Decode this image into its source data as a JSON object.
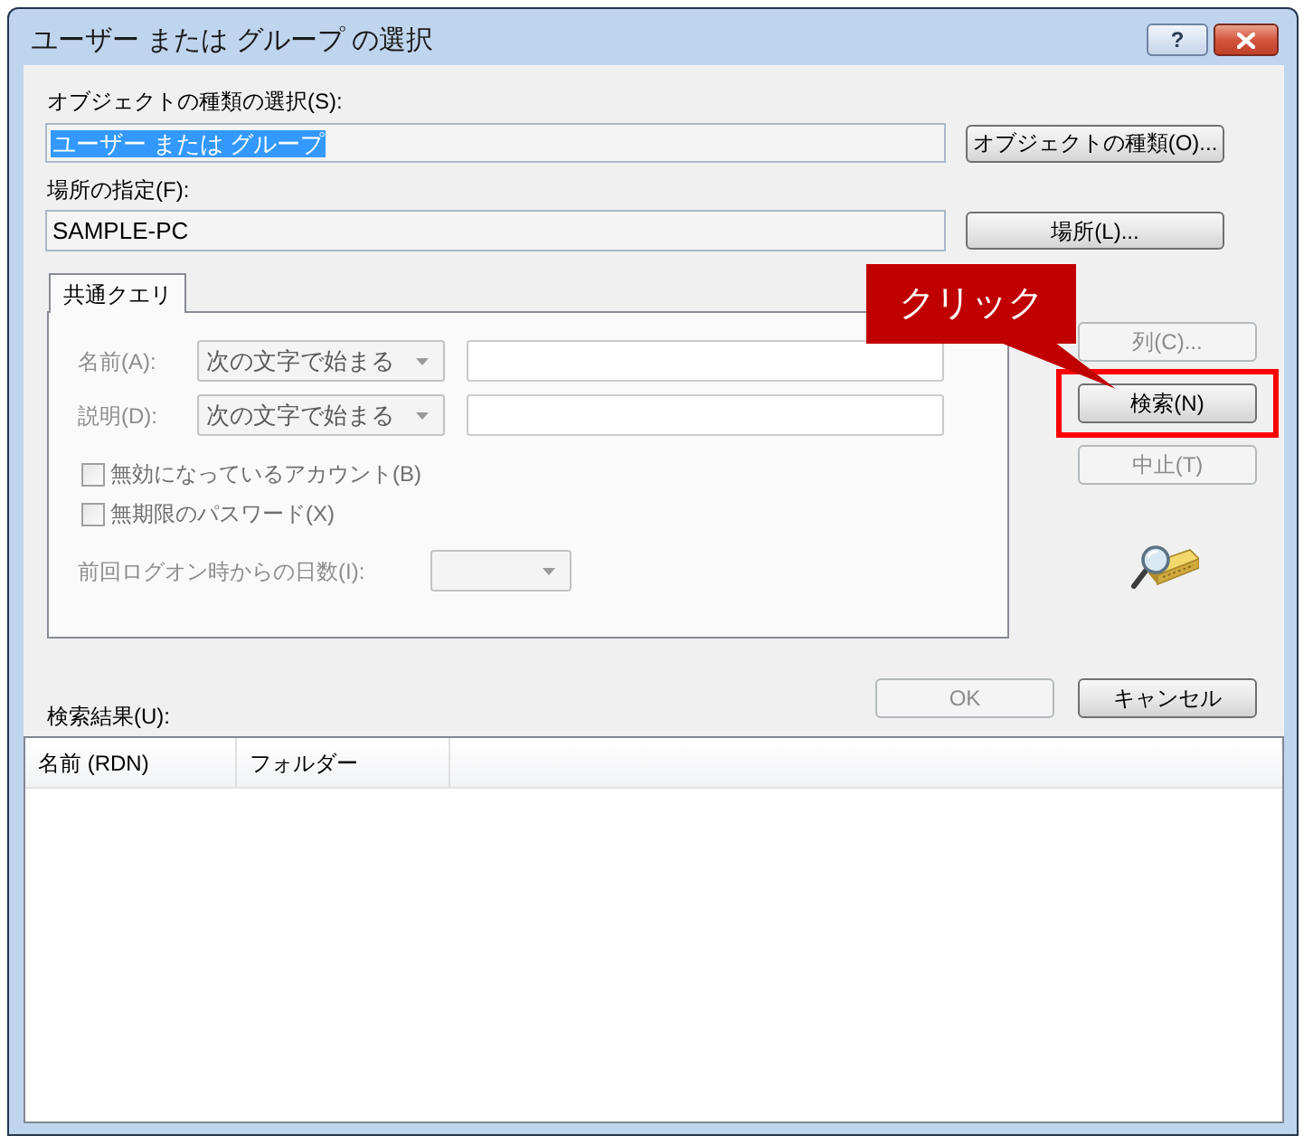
{
  "window": {
    "title": "ユーザー または グループ の選択",
    "help_button": "?"
  },
  "object_types": {
    "label": "オブジェクトの種類の選択(S):",
    "value": "ユーザー または グループ",
    "text_selected": true,
    "button": "オブジェクトの種類(O)..."
  },
  "location": {
    "label": "場所の指定(F):",
    "value": "SAMPLE-PC",
    "text_selected": false,
    "button": "場所(L)..."
  },
  "query": {
    "tabs": [
      {
        "label": "共通クエリ",
        "selected": true
      }
    ],
    "disabled": true,
    "rows": [
      {
        "kind": "filter",
        "label": "名前(A):",
        "operator": "次の文字で始まる"
      },
      {
        "kind": "filter",
        "label": "説明(D):",
        "operator": "次の文字で始まる"
      },
      {
        "kind": "checkbox",
        "label": "無効になっているアカウント(B)",
        "checked": false
      },
      {
        "kind": "checkbox",
        "label": "無期限のパスワード(X)",
        "checked": false
      },
      {
        "kind": "days",
        "label": "前回ログオン時からの日数(I):"
      }
    ]
  },
  "side_buttons": [
    {
      "label": "列(C)...",
      "disabled": true,
      "highlighted": false
    },
    {
      "label": "検索(N)",
      "disabled": false,
      "highlighted": true
    },
    {
      "label": "中止(T)",
      "disabled": true,
      "highlighted": false
    }
  ],
  "callout": {
    "text": "クリック"
  },
  "dialog_buttons": [
    {
      "label": "OK",
      "disabled": true
    },
    {
      "label": "キャンセル",
      "disabled": false
    }
  ],
  "results": {
    "label": "検索結果(U):",
    "columns": [
      "名前 (RDN)",
      "フォルダー"
    ]
  }
}
